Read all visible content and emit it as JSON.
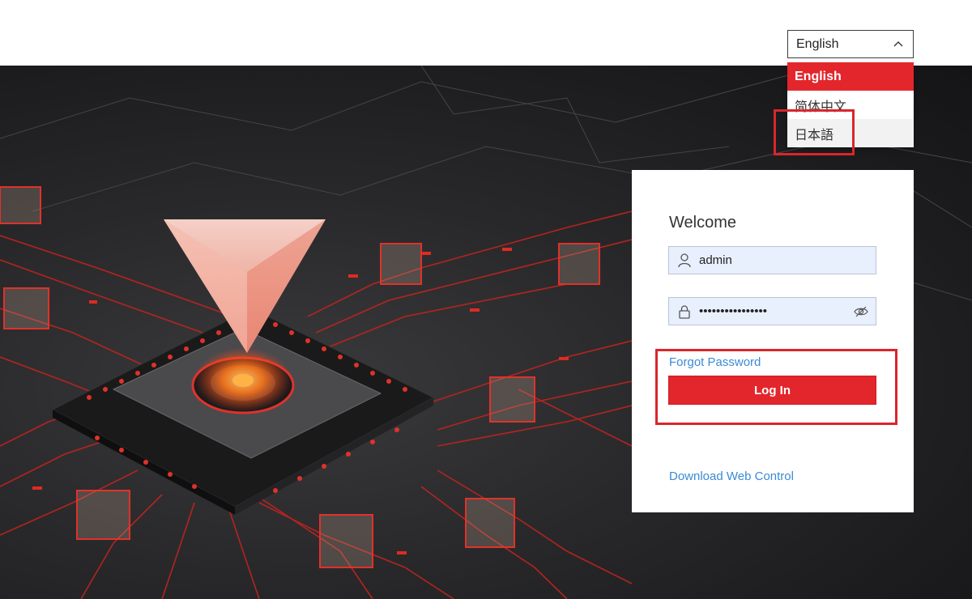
{
  "language": {
    "current": "English",
    "options": [
      {
        "label": "English",
        "state": "selected"
      },
      {
        "label": "简体中文",
        "state": "normal"
      },
      {
        "label": "日本語",
        "state": "hover"
      }
    ]
  },
  "login": {
    "title": "Welcome",
    "username_value": "admin",
    "password_value": "••••••••••••••••",
    "forgot_label": "Forgot Password",
    "login_label": "Log In",
    "download_label": "Download Web Control"
  },
  "colors": {
    "accent": "#e3262c",
    "link": "#3a8bd6",
    "input_bg": "#e8f0fe",
    "background_dark": "#1c1c1e"
  },
  "icons": [
    "chevron-up-icon",
    "user-icon",
    "lock-icon",
    "eye-off-icon"
  ]
}
